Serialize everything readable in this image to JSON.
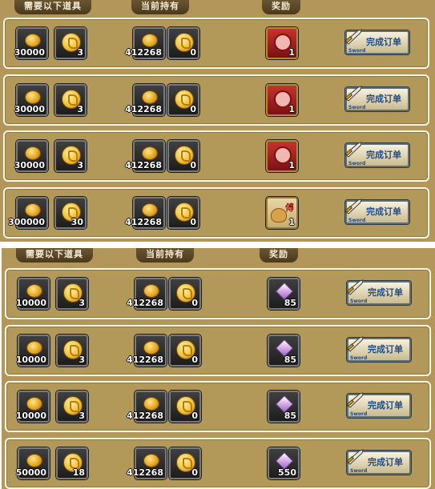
{
  "headers": {
    "required": "需要以下道具",
    "current": "当前持有",
    "reward": "奖励"
  },
  "button": {
    "label": "完成订单",
    "sub": "Sword"
  },
  "panel_a": [
    {
      "req_coins": "30000",
      "req_tokens": "3",
      "have_coins": "412268",
      "have_tokens": "0",
      "reward_type": "scroll",
      "reward_qty": "1"
    },
    {
      "req_coins": "30000",
      "req_tokens": "3",
      "have_coins": "412268",
      "have_tokens": "0",
      "reward_type": "scroll",
      "reward_qty": "1"
    },
    {
      "req_coins": "30000",
      "req_tokens": "3",
      "have_coins": "412268",
      "have_tokens": "0",
      "reward_type": "scroll",
      "reward_qty": "1"
    },
    {
      "req_coins": "300000",
      "req_tokens": "30",
      "have_coins": "412268",
      "have_tokens": "0",
      "reward_type": "bag",
      "reward_qty": "1"
    }
  ],
  "panel_b": [
    {
      "req_coins": "10000",
      "req_tokens": "3",
      "have_coins": "412268",
      "have_tokens": "0",
      "reward_type": "gem",
      "reward_qty": "85"
    },
    {
      "req_coins": "10000",
      "req_tokens": "3",
      "have_coins": "412268",
      "have_tokens": "0",
      "reward_type": "gem",
      "reward_qty": "85"
    },
    {
      "req_coins": "10000",
      "req_tokens": "3",
      "have_coins": "412268",
      "have_tokens": "0",
      "reward_type": "gem",
      "reward_qty": "85"
    },
    {
      "req_coins": "50000",
      "req_tokens": "18",
      "have_coins": "412268",
      "have_tokens": "0",
      "reward_type": "gem",
      "reward_qty": "550"
    }
  ]
}
